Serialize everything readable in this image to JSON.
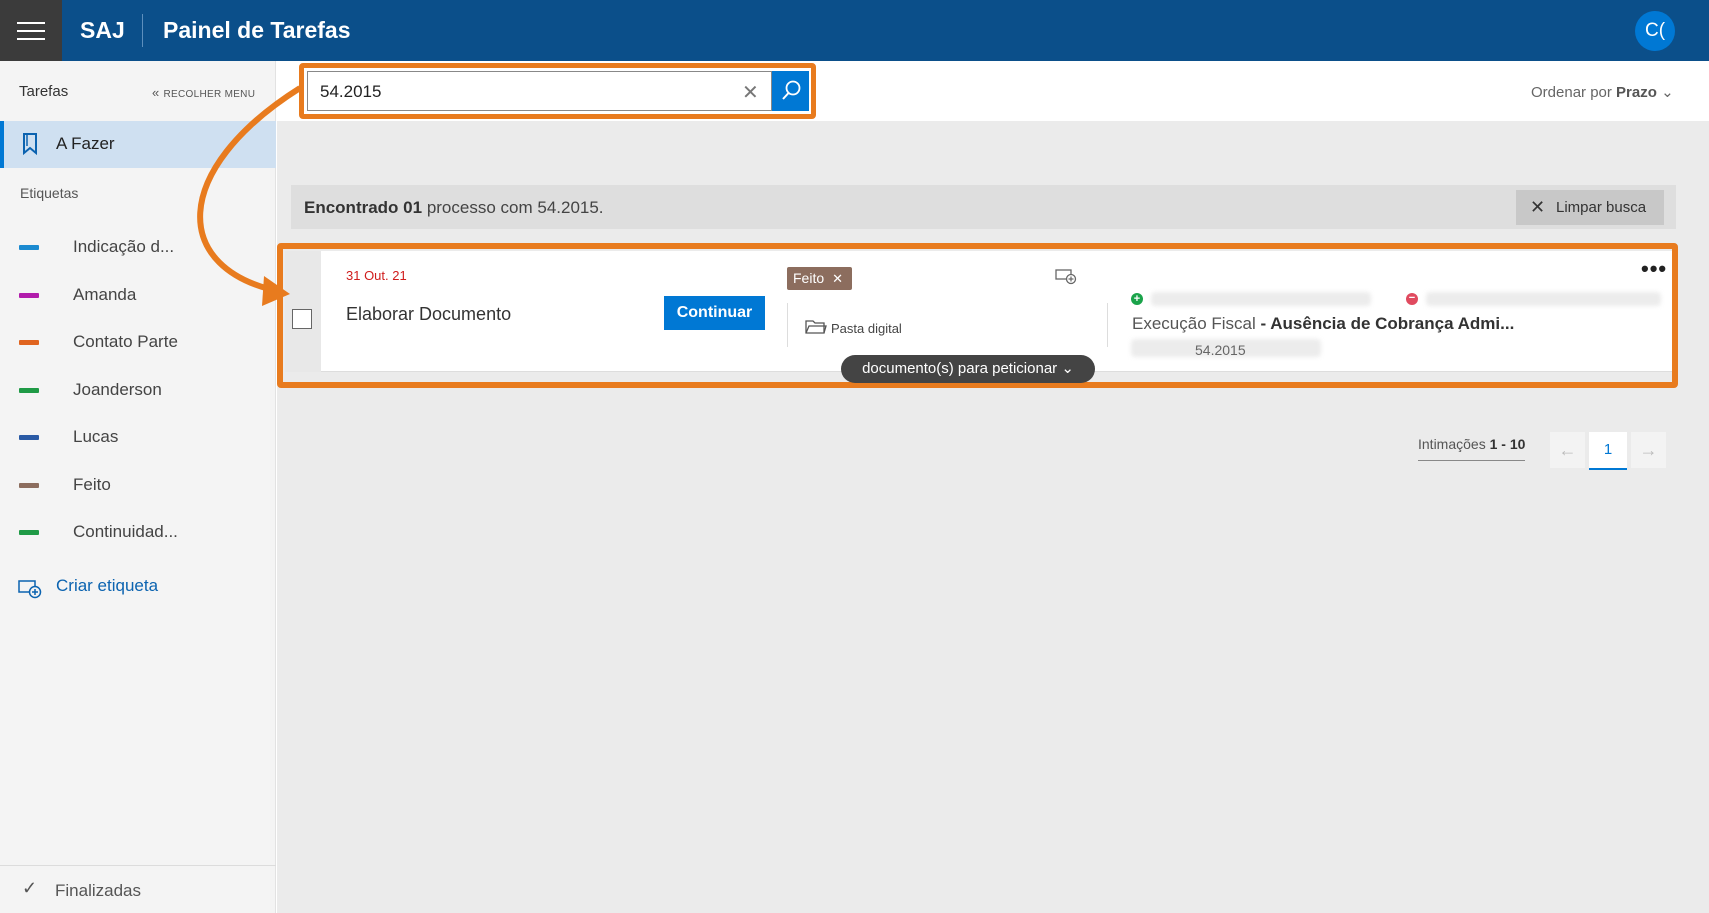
{
  "header": {
    "brand": "SAJ",
    "title": "Painel de Tarefas",
    "avatar_initials": "C("
  },
  "sidebar": {
    "section_title": "Tarefas",
    "collapse_label": "RECOLHER MENU",
    "active_item": "A Fazer",
    "labels_title": "Etiquetas",
    "tags": [
      {
        "label": "Indicação d...",
        "color": "#1b8ad0"
      },
      {
        "label": "Amanda",
        "color": "#b11cab"
      },
      {
        "label": "Contato Parte",
        "color": "#e0641f"
      },
      {
        "label": "Joanderson",
        "color": "#1f9a46"
      },
      {
        "label": "Lucas",
        "color": "#2a5aa5"
      },
      {
        "label": "Feito",
        "color": "#8c6d5e"
      },
      {
        "label": "Continuidad...",
        "color": "#1f9a46"
      }
    ],
    "create_tag": "Criar etiqueta",
    "finished": "Finalizadas"
  },
  "search": {
    "value": "54.2015"
  },
  "sort": {
    "prefix": "Ordenar por",
    "value": "Prazo"
  },
  "result": {
    "found_bold": "Encontrado 01",
    "found_rest": " processo com 54.2015.",
    "clear_label": "Limpar busca"
  },
  "task": {
    "date": "31 Out. 21",
    "title": "Elaborar Documento",
    "action": "Continuar",
    "tag": "Feito",
    "folder": "Pasta digital",
    "class_prefix": "Execução Fiscal",
    "class_subject": " - Ausência de Cobrança Admi...",
    "process_number": "54.2015",
    "docs_label": "documento(s) para peticionar"
  },
  "pagination": {
    "prefix": "Intimações",
    "range": "1 - 10",
    "current_page": "1"
  },
  "colors": {
    "header": "#0b4f8a",
    "accent": "#0078d4",
    "highlight": "#e87b1e"
  }
}
